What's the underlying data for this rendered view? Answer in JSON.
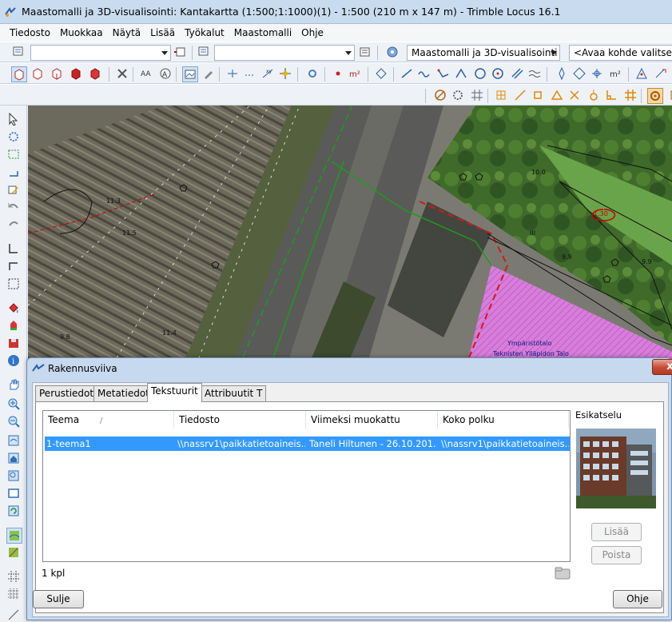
{
  "window": {
    "title": "Maastomalli ja 3D-visualisointi: Kantakartta  (1:500;1:1000)(1) - 1:500 (210 m x 147 m) - Trimble Locus 16.1"
  },
  "menu": [
    "Tiedosto",
    "Muokkaa",
    "Näytä",
    "Lisää",
    "Työkalut",
    "Maastomalli",
    "Ohje"
  ],
  "toolbar": {
    "combo1_value": "",
    "combo2_value": "",
    "workspace_value": "Maastomalli ja 3D-visualisointi",
    "object_prompt": "<Avaa kohde valitsemall"
  },
  "map": {
    "labels": [
      "10.0",
      "11.3",
      "11.5",
      "11.4",
      "9.9",
      "9.9",
      "9.8",
      "1.30",
      "III",
      "Ympäristötalo",
      "Teknisten Ylläpidon Talo"
    ]
  },
  "dialog": {
    "title": "Rakennusviiva",
    "close": "x",
    "tabs": [
      "Perustiedot",
      "Metatiedot",
      "Tekstuurit",
      "Attribuutit T"
    ],
    "active_tab": "Tekstuurit",
    "columns": [
      "Teema",
      "Tiedosto",
      "Viimeksi muokattu",
      "Koko polku"
    ],
    "sort_indicator": "/",
    "rows": [
      {
        "teema": "1-teema1",
        "tiedosto": "\\\\nassrv1\\paikkatietoaineis...",
        "muokattu": "Taneli Hiltunen - 26.10.201...",
        "polku": "\\\\nassrv1\\paikkatietoaineis..."
      }
    ],
    "count": "1 kpl",
    "preview_label": "Esikatselu",
    "add_button": "Lisää",
    "remove_button": "Poista",
    "close_button": "Sulje",
    "help_button": "Ohje"
  }
}
